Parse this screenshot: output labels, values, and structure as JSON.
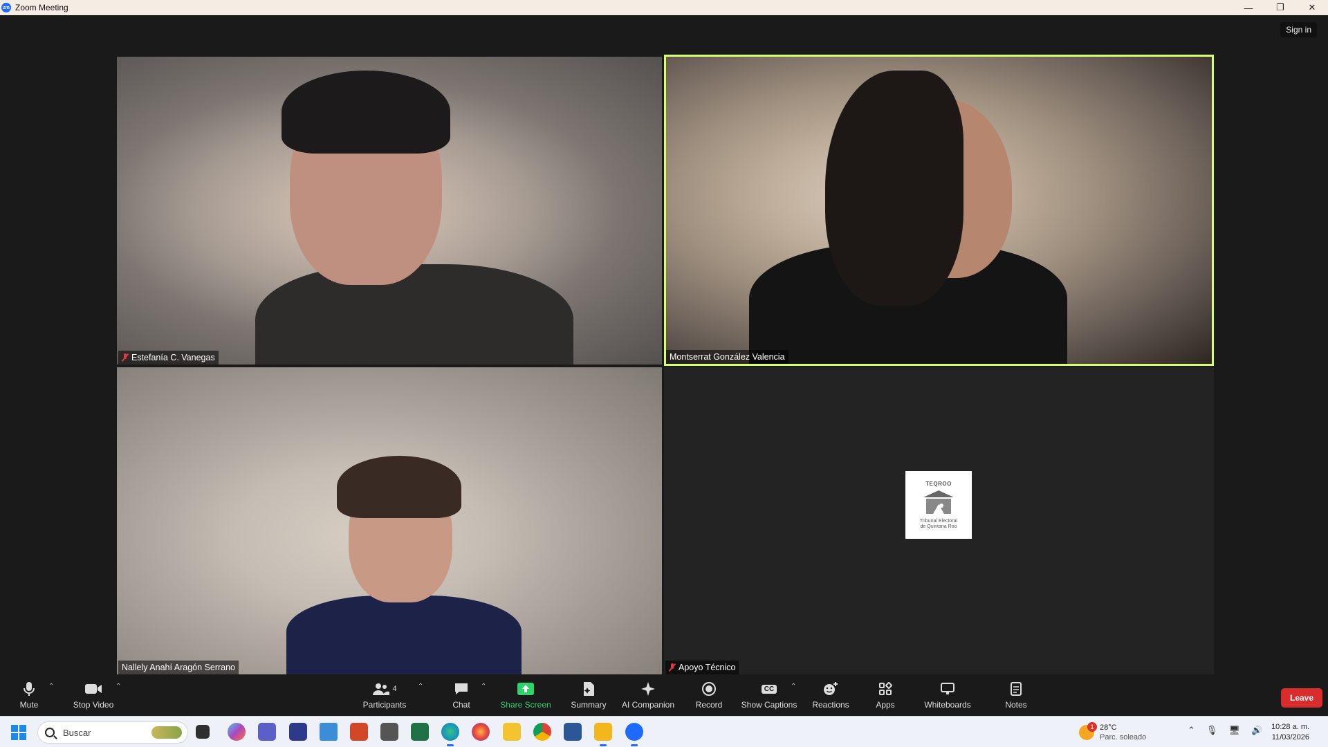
{
  "window": {
    "title": "Zoom Meeting",
    "icon": "zm"
  },
  "window_controls": {
    "minimize": "—",
    "restore": "❐",
    "close": "✕"
  },
  "header": {
    "sign_in": "Sign in"
  },
  "participants": [
    {
      "name": "Estefanía C. Vanegas",
      "muted": true
    },
    {
      "name": "Montserrat González Valencia",
      "muted": false,
      "active_speaker": true
    },
    {
      "name": "Nallely Anahí Aragón Serrano",
      "muted": false
    },
    {
      "name": "Apoyo Técnico",
      "muted": true,
      "logo": {
        "top": "TEQROO",
        "line1": "Tribunal Electoral",
        "line2": "de Quintana Roo"
      }
    }
  ],
  "toolbar": {
    "mute": "Mute",
    "stop_video": "Stop Video",
    "participants": "Participants",
    "participants_count": "4",
    "chat": "Chat",
    "share_screen": "Share Screen",
    "summary": "Summary",
    "ai_companion": "AI Companion",
    "record": "Record",
    "show_captions": "Show Captions",
    "captions_icon": "CC",
    "reactions": "Reactions",
    "apps": "Apps",
    "whiteboards": "Whiteboards",
    "notes": "Notes",
    "leave": "Leave"
  },
  "taskbar": {
    "search_placeholder": "Buscar",
    "weather": {
      "temp": "28°C",
      "desc": "Parc. soleado",
      "badge": "1"
    },
    "time": "10:28 a. m.",
    "date": "11/03/2026"
  },
  "colors": {
    "active_border": "#d8ff6b",
    "share_green": "#2ed36b",
    "leave_red": "#d92c2c",
    "muted_red": "#e0393e"
  }
}
